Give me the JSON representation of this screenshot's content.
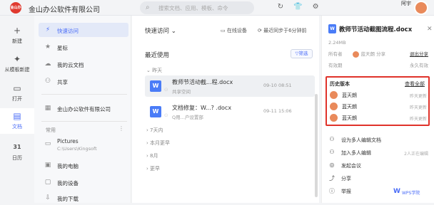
{
  "topbar": {
    "logo_text": "金山办公",
    "company": "金山办公软件有限公司",
    "search_placeholder": "搜索文档、应用、模板、命令",
    "user_name": "阿宇"
  },
  "leftnav": [
    {
      "label": "新建",
      "icon": "+"
    },
    {
      "label": "从模板新建",
      "icon": "✦"
    },
    {
      "label": "打开",
      "icon": "▭"
    },
    {
      "label": "文档",
      "icon": "▤"
    },
    {
      "label": "日历",
      "icon": "31"
    }
  ],
  "sidebar": {
    "items": [
      {
        "label": "快速访问",
        "icon": "⚡"
      },
      {
        "label": "星标",
        "icon": "★"
      },
      {
        "label": "我的云文档",
        "icon": "☁"
      },
      {
        "label": "共享",
        "icon": "⚇"
      },
      {
        "label": "金山办公软件有限公司",
        "icon": "▦"
      }
    ],
    "section_label": "常用",
    "common": [
      {
        "label": "Pictures",
        "sub": "C:\\Users\\Kingsoft"
      },
      {
        "label": "我的电脑"
      },
      {
        "label": "我的设备"
      },
      {
        "label": "我的下载"
      }
    ]
  },
  "main": {
    "crumb": "快速访问 ⌄",
    "online_device": "在线设备",
    "sync_status": "最近同步于6分钟前",
    "recent_title": "最近使用",
    "filter": "筛选",
    "groups": {
      "yesterday": "⌄ 昨天",
      "week": "› 7天内",
      "month": "› 本月更早",
      "aug": "› 8月",
      "older": "› 更早"
    },
    "files": [
      {
        "name": "教师节活动截...程.docx",
        "sub": "共享空间",
        "date": "09-10 08:51"
      },
      {
        "name": "文档修复：W...? .docx",
        "sub": "Q用...户设置部",
        "date": "09-11 15:06"
      }
    ]
  },
  "panel": {
    "file_title": "教师节活动截图流程.docx",
    "size": "2.24MB",
    "owner_label": "所有者",
    "owner_name": "蓝天朗 分享",
    "exit_share": "退出分享",
    "valid_label": "有效期",
    "valid_value": "永久有效",
    "history_title": "历史版本",
    "history_all": "查看全部",
    "history": [
      {
        "name": "蓝天朗",
        "time": "昨天更新"
      },
      {
        "name": "蓝天朗",
        "time": "昨天更新"
      },
      {
        "name": "蓝天朗",
        "time": "昨天更新"
      }
    ],
    "actions": [
      {
        "label": "设为多人编辑文档",
        "icon": "⚇",
        "right": ""
      },
      {
        "label": "加入多人编辑",
        "icon": "⚇",
        "right": "2人正在编辑"
      },
      {
        "label": "发起会议",
        "icon": "◎",
        "right": ""
      },
      {
        "label": "分享",
        "icon": "⤴",
        "right": ""
      },
      {
        "label": "举报",
        "icon": "ⓘ",
        "right": ""
      }
    ],
    "brand": "WPS学院"
  }
}
